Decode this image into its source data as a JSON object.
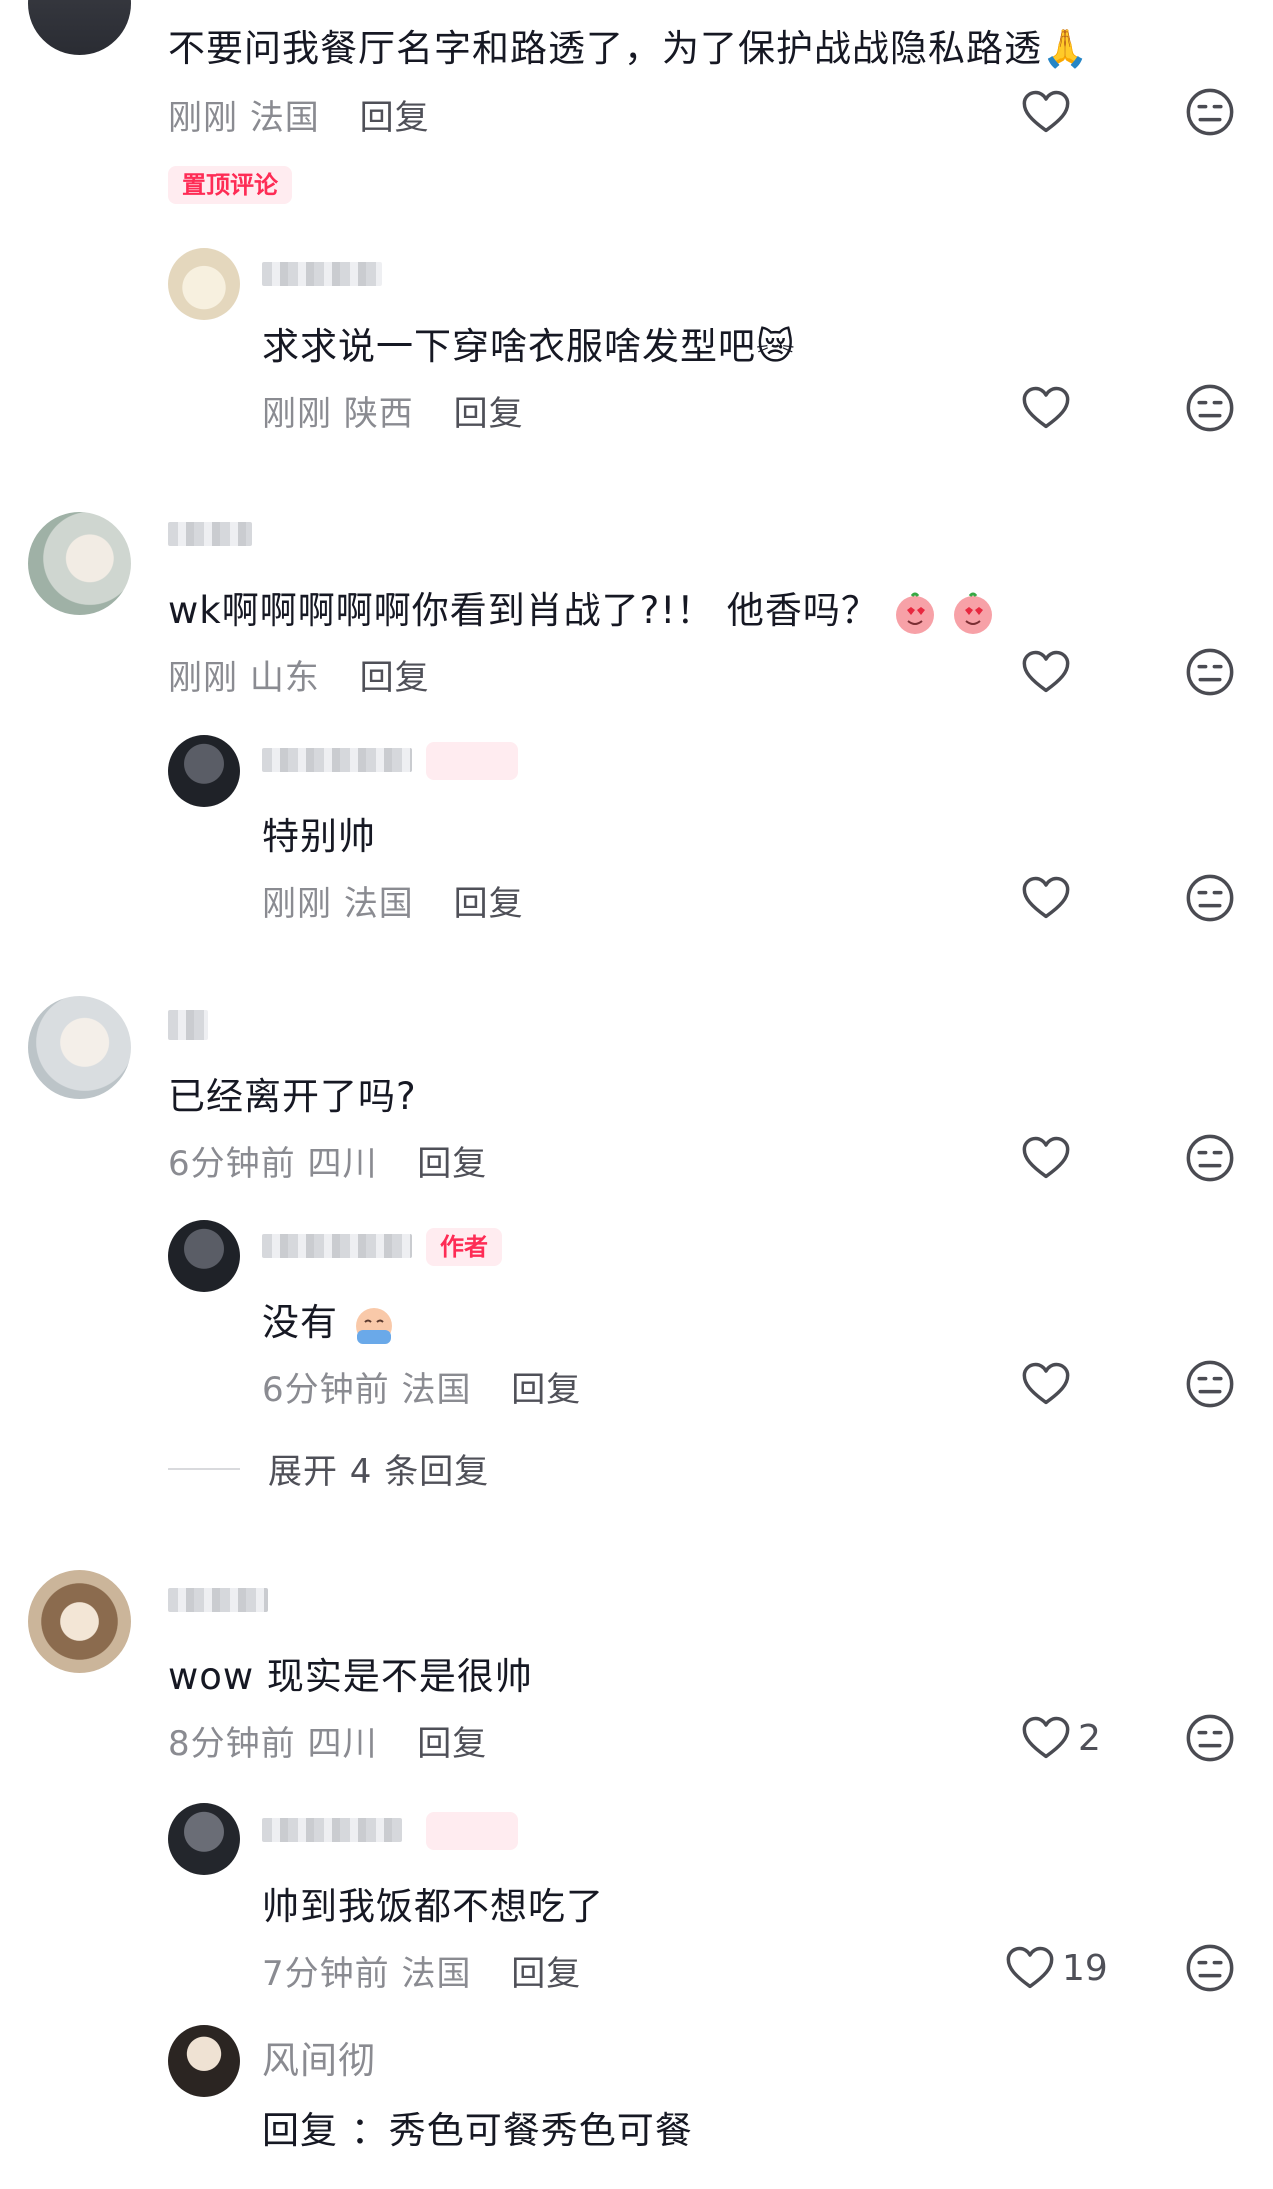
{
  "comments": [
    {
      "text": "不要问我餐厅名字和路透了，为了保护战战隐私路透🙏",
      "time": "刚刚",
      "location": "法国",
      "reply_label": "回复",
      "tag": "置顶评论",
      "replies": [
        {
          "text": "求求说一下穿啥衣服啥发型吧😿",
          "time": "刚刚",
          "location": "陕西",
          "reply_label": "回复"
        }
      ]
    },
    {
      "text": "wk啊啊啊啊啊你看到肖战了?!！ 他香吗？",
      "time": "刚刚",
      "location": "山东",
      "reply_label": "回复",
      "replies": [
        {
          "text": "特别帅",
          "time": "刚刚",
          "location": "法国",
          "reply_label": "回复"
        }
      ]
    },
    {
      "text": "已经离开了吗?",
      "time": "6分钟前",
      "location": "四川",
      "reply_label": "回复",
      "replies": [
        {
          "text": "没有",
          "time": "6分钟前",
          "location": "法国",
          "reply_label": "回复",
          "badge": "作者"
        }
      ],
      "expand_label": "展开 4 条回复"
    },
    {
      "text": "wow 现实是不是很帅",
      "time": "8分钟前",
      "location": "四川",
      "reply_label": "回复",
      "likes": "2",
      "replies": [
        {
          "text": "帅到我饭都不想吃了",
          "time": "7分钟前",
          "location": "法国",
          "reply_label": "回复",
          "likes": "19"
        },
        {
          "username": "风间彻",
          "text": "回复 ：秀色可餐秀色可餐"
        }
      ]
    }
  ]
}
